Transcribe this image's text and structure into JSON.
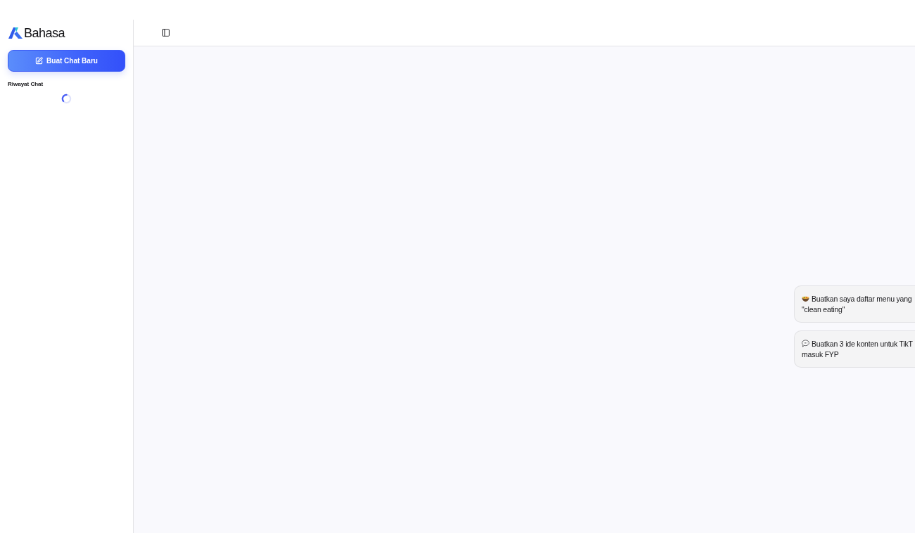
{
  "sidebar": {
    "logo": {
      "text": "Bahasa"
    },
    "new_chat_button": {
      "label": "Buat Chat Baru"
    },
    "history": {
      "title": "Riwayat Chat",
      "loading": true
    }
  },
  "suggestions": [
    {
      "kind": "food",
      "lines": [
        "Buatkan saya daftar menu yang",
        "\"clean eating\""
      ]
    },
    {
      "kind": "chat",
      "lines": [
        "Buatkan 3 ide konten untuk TikT",
        "masuk FYP"
      ]
    }
  ]
}
